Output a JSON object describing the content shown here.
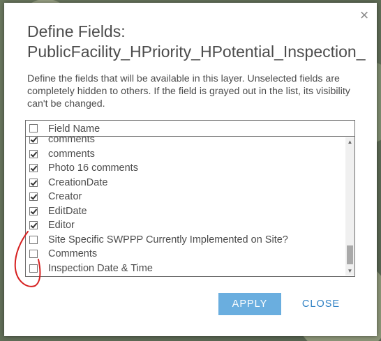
{
  "dialog": {
    "title_line1": "Define Fields:",
    "title_line2": "PublicFacility_HPriority_HPotential_Inspection_",
    "description": "Define the fields that will be available in this layer. Unselected fields are completely hidden to others. If the field is grayed out in the list, its visibility can't be changed.",
    "close_glyph": "×"
  },
  "fields": {
    "header_label": "Field Name",
    "header_checked": false,
    "rows": [
      {
        "label": "comments",
        "checked": true
      },
      {
        "label": "comments",
        "checked": true
      },
      {
        "label": "Photo 16 comments",
        "checked": true
      },
      {
        "label": "CreationDate",
        "checked": true
      },
      {
        "label": "Creator",
        "checked": true
      },
      {
        "label": "EditDate",
        "checked": true
      },
      {
        "label": "Editor",
        "checked": true
      },
      {
        "label": "Site Specific SWPPP Currently Implemented on Site?",
        "checked": false
      },
      {
        "label": "Comments",
        "checked": false
      },
      {
        "label": "Inspection Date & Time",
        "checked": false
      }
    ]
  },
  "buttons": {
    "apply": "APPLY",
    "close": "CLOSE"
  },
  "colors": {
    "apply_bg": "#6aaedf",
    "close_text": "#2f81c4",
    "annotation": "#d62020"
  }
}
